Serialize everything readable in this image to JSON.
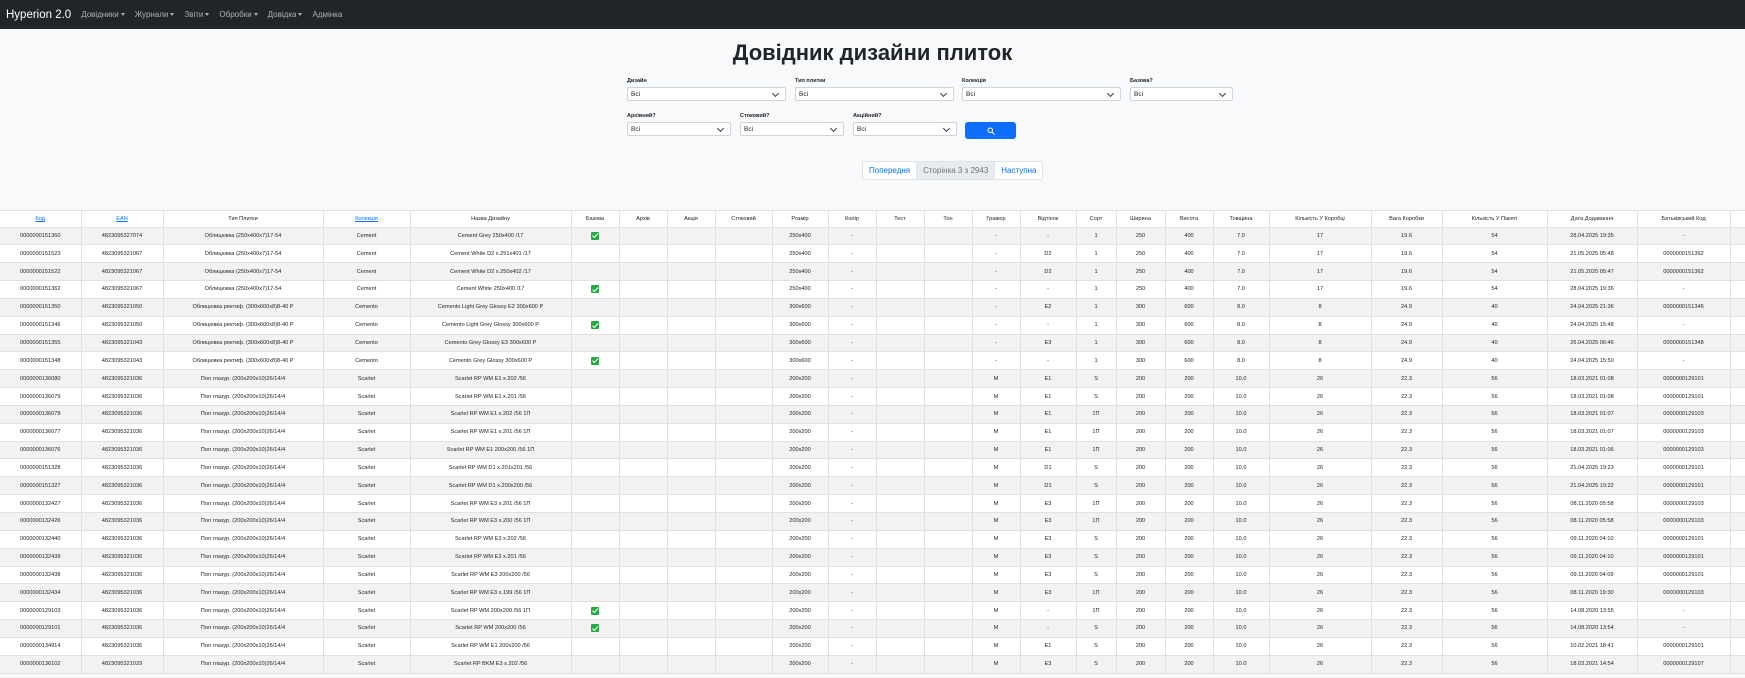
{
  "navbar": {
    "brand": "Hyperion 2.0",
    "items": [
      {
        "label": "Довідники",
        "dropdown": true
      },
      {
        "label": "Журнали",
        "dropdown": true
      },
      {
        "label": "Звіти",
        "dropdown": true
      },
      {
        "label": "Обробки",
        "dropdown": true
      },
      {
        "label": "Довідка",
        "dropdown": true
      },
      {
        "label": "Адмінка",
        "dropdown": false
      }
    ]
  },
  "page": {
    "title": "Довідник дизайни плиток"
  },
  "filters": {
    "design": {
      "label": "Дизайн",
      "value": "Всі"
    },
    "tile_type": {
      "label": "Тип плитки",
      "value": "Всі"
    },
    "collection": {
      "label": "Колекція",
      "value": "Всі"
    },
    "base": {
      "label": "Базова?",
      "value": "Всі"
    },
    "archive": {
      "label": "Архівний?",
      "value": "Всі"
    },
    "stock": {
      "label": "Стоковий?",
      "value": "Всі"
    },
    "promo": {
      "label": "Акційний?",
      "value": "Всі"
    },
    "search_icon": "search-icon"
  },
  "pagination": {
    "prev": "Попередня",
    "current": "Сторінка 3 з 2943",
    "next": "Наступна"
  },
  "colors": {
    "navbar": "#212529",
    "primary": "#0d6efd",
    "check": "#28a745"
  },
  "table": {
    "columns": [
      {
        "label": "Код",
        "sortable": true
      },
      {
        "label": "EAN",
        "sortable": true
      },
      {
        "label": "Тип Плитки",
        "sortable": false
      },
      {
        "label": "Колекція",
        "sortable": true
      },
      {
        "label": "Назва Дизайну",
        "sortable": false
      },
      {
        "label": "Базова",
        "sortable": false
      },
      {
        "label": "Архів",
        "sortable": false
      },
      {
        "label": "Акція",
        "sortable": false
      },
      {
        "label": "Стоковий",
        "sortable": false
      },
      {
        "label": "Розмір",
        "sortable": false
      },
      {
        "label": "Колір",
        "sortable": false
      },
      {
        "label": "Тест",
        "sortable": false
      },
      {
        "label": "Тон",
        "sortable": false
      },
      {
        "label": "Гравюр",
        "sortable": false
      },
      {
        "label": "Відтінок",
        "sortable": false
      },
      {
        "label": "Сорт",
        "sortable": false
      },
      {
        "label": "Ширина",
        "sortable": false
      },
      {
        "label": "Висота",
        "sortable": false
      },
      {
        "label": "Товщина",
        "sortable": false
      },
      {
        "label": "Кількість У Коробці",
        "sortable": false
      },
      {
        "label": "Вага Коробки",
        "sortable": false
      },
      {
        "label": "Кількість У Пакеті",
        "sortable": false
      },
      {
        "label": "Дата Додавання",
        "sortable": false
      },
      {
        "label": "Батьківський Код",
        "sortable": false
      },
      {
        "label": "",
        "sortable": false
      }
    ],
    "rows": [
      [
        "0000000151360",
        "4823095327074",
        "Облицювка (250х400х7)17-54",
        "Cement",
        "Cement Grey 250x400 /17",
        true,
        "",
        "",
        "",
        "250x400",
        "-",
        "",
        "",
        "-",
        "-",
        "1",
        "250",
        "400",
        "7.0",
        "17",
        "19.6",
        "54",
        "28.04.2025 19:35",
        "-",
        ""
      ],
      [
        "0000000151523",
        "4823095321067",
        "Облицювка (250х400х7)17-54",
        "Cement",
        "Cement White D2 x.251x401 /17",
        false,
        "",
        "",
        "",
        "250x400",
        "-",
        "",
        "",
        "-",
        "D2",
        "1",
        "250",
        "400",
        "7.0",
        "17",
        "19.6",
        "54",
        "21.05.2025 05:48",
        "0000000151362",
        ""
      ],
      [
        "0000000151522",
        "4823095321067",
        "Облицювка (250х400х7)17-54",
        "Cement",
        "Cement White D2 x.250x402 /17",
        false,
        "",
        "",
        "",
        "250x400",
        "-",
        "",
        "",
        "-",
        "D2",
        "1",
        "250",
        "400",
        "7.0",
        "17",
        "19.6",
        "54",
        "21.05.2025 05:47",
        "0000000151362",
        ""
      ],
      [
        "0000000151362",
        "4823095321067",
        "Облицювка (250х400х7)17-54",
        "Cement",
        "Cement White 250x400 /17",
        true,
        "",
        "",
        "",
        "250x400",
        "-",
        "",
        "",
        "-",
        "-",
        "1",
        "250",
        "400",
        "7.0",
        "17",
        "19.6",
        "54",
        "28.04.2025 19:36",
        "-",
        ""
      ],
      [
        "0000000151350",
        "4823095321050",
        "Облицювка ректиф. (300х600х8)8-40 Р",
        "Cemento",
        "Cemento Light Grey Glossy E2 300x600 P",
        false,
        "",
        "",
        "",
        "300x600",
        "-",
        "",
        "",
        "-",
        "E2",
        "1",
        "300",
        "600",
        "8.0",
        "8",
        "24.9",
        "40",
        "24.04.2025 21:36",
        "0000000151346",
        ""
      ],
      [
        "0000000151346",
        "4823095321050",
        "Облицювка ректиф. (300х600х8)8-40 Р",
        "Cemento",
        "Cemento Light Grey Glossy 300x600 P",
        true,
        "",
        "",
        "",
        "300x600",
        "-",
        "",
        "",
        "-",
        "-",
        "1",
        "300",
        "600",
        "8.0",
        "8",
        "24.9",
        "40",
        "24.04.2025 15:48",
        "-",
        ""
      ],
      [
        "0000000151355",
        "4823095321043",
        "Облицювка ректиф. (300х600х8)8-40 Р",
        "Cemento",
        "Cemento Grey Glossy E3 300x600 P",
        false,
        "",
        "",
        "",
        "300x600",
        "-",
        "",
        "",
        "-",
        "E3",
        "1",
        "300",
        "600",
        "8.0",
        "8",
        "24.9",
        "40",
        "26.04.2025 06:46",
        "0000000151348",
        ""
      ],
      [
        "0000000151348",
        "4823095321043",
        "Облицювка ректиф. (300х600х8)8-40 Р",
        "Cemento",
        "Cemento Grey Glossy 300x600 P",
        true,
        "",
        "",
        "",
        "300x600",
        "-",
        "",
        "",
        "-",
        "-",
        "1",
        "300",
        "600",
        "8.0",
        "8",
        "24.9",
        "40",
        "24.04.2025 15:50",
        "-",
        ""
      ],
      [
        "0000000136080",
        "4823095321036",
        "Пол глазур. (200х200х10)26/14/4",
        "Scarlet",
        "Scarlet RP WM E1 x.202 /56",
        false,
        "",
        "",
        "",
        "200x200",
        "-",
        "",
        "",
        "M",
        "E1",
        "S",
        "200",
        "200",
        "10.0",
        "26",
        "22.3",
        "56",
        "18.03.2021 01:08",
        "0000000129101",
        ""
      ],
      [
        "0000000136079",
        "4823095321036",
        "Пол глазур. (200х200х10)26/14/4",
        "Scarlet",
        "Scarlet RP WM E1 x.201 /56",
        false,
        "",
        "",
        "",
        "200x200",
        "-",
        "",
        "",
        "M",
        "E1",
        "S",
        "200",
        "200",
        "10.0",
        "26",
        "22.3",
        "56",
        "18.03.2021 01:08",
        "0000000129101",
        ""
      ],
      [
        "0000000136078",
        "4823095321036",
        "Пол глазур. (200х200х10)26/14/4",
        "Scarlet",
        "Scarlet RP WM E1 x.202 /56 1П",
        false,
        "",
        "",
        "",
        "200x200",
        "-",
        "",
        "",
        "M",
        "E1",
        "1П",
        "200",
        "200",
        "10.0",
        "26",
        "22.3",
        "56",
        "18.03.2021 01:07",
        "0000000129103",
        ""
      ],
      [
        "0000000136077",
        "4823095321036",
        "Пол глазур. (200х200х10)26/14/4",
        "Scarlet",
        "Scarlet RP WM E1 x.201 /56 1П",
        false,
        "",
        "",
        "",
        "200x200",
        "-",
        "",
        "",
        "M",
        "E1",
        "1П",
        "200",
        "200",
        "10.0",
        "26",
        "22.3",
        "56",
        "18.03.2021 01:07",
        "0000000129103",
        ""
      ],
      [
        "0000000136076",
        "4823095321036",
        "Пол глазур. (200х200х10)26/14/4",
        "Scarlet",
        "Scarlet RP WM E1 200x200 /56 1П",
        false,
        "",
        "",
        "",
        "200x200",
        "-",
        "",
        "",
        "M",
        "E1",
        "1П",
        "200",
        "200",
        "10.0",
        "26",
        "22.3",
        "56",
        "18.03.2021 01:06",
        "0000000129103",
        ""
      ],
      [
        "0000000151328",
        "4823095321036",
        "Пол глазур. (200х200х10)26/14/4",
        "Scarlet",
        "Scarlet RP WM D1 x.201x201 /56",
        false,
        "",
        "",
        "",
        "200x200",
        "-",
        "",
        "",
        "M",
        "D1",
        "S",
        "200",
        "200",
        "10.0",
        "26",
        "22.3",
        "56",
        "21.04.2025 19:23",
        "0000000129101",
        ""
      ],
      [
        "0000000151327",
        "4823095321036",
        "Пол глазур. (200х200х10)26/14/4",
        "Scarlet",
        "Scarlet RP WM D1 x.200x200 /56",
        false,
        "",
        "",
        "",
        "200x200",
        "-",
        "",
        "",
        "M",
        "D1",
        "S",
        "200",
        "200",
        "10.0",
        "26",
        "22.3",
        "56",
        "21.04.2025 19:22",
        "0000000129101",
        ""
      ],
      [
        "0000000132427",
        "4823095321036",
        "Пол глазур. (200х200х10)26/14/4",
        "Scarlet",
        "Scarlet RP WM E3 x.201 /56 1П",
        false,
        "",
        "",
        "",
        "200x200",
        "-",
        "",
        "",
        "M",
        "E3",
        "1П",
        "200",
        "200",
        "10.0",
        "26",
        "22.3",
        "56",
        "08.11.2020 05:58",
        "0000000129103",
        ""
      ],
      [
        "0000000132426",
        "4823095321036",
        "Пол глазур. (200х200х10)26/14/4",
        "Scarlet",
        "Scarlet RP WM E3 x.200 /56 1П",
        false,
        "",
        "",
        "",
        "200x200",
        "-",
        "",
        "",
        "M",
        "E3",
        "1П",
        "200",
        "200",
        "10.0",
        "26",
        "22.3",
        "56",
        "08.11.2020 05:58",
        "0000000129103",
        ""
      ],
      [
        "0000000132440",
        "4823095321036",
        "Пол глазур. (200х200х10)26/14/4",
        "Scarlet",
        "Scarlet RP WM E3 x.202 /56",
        false,
        "",
        "",
        "",
        "200x200",
        "-",
        "",
        "",
        "M",
        "E3",
        "S",
        "200",
        "200",
        "10.0",
        "26",
        "22.3",
        "56",
        "09.11.2020 04:10",
        "0000000129101",
        ""
      ],
      [
        "0000000132439",
        "4823095321036",
        "Пол глазур. (200х200х10)26/14/4",
        "Scarlet",
        "Scarlet RP WM E3 x.201 /56",
        false,
        "",
        "",
        "",
        "200x200",
        "-",
        "",
        "",
        "M",
        "E3",
        "S",
        "200",
        "200",
        "10.0",
        "26",
        "22.3",
        "56",
        "09.11.2020 04:10",
        "0000000129101",
        ""
      ],
      [
        "0000000132438",
        "4823095321036",
        "Пол глазур. (200х200х10)26/14/4",
        "Scarlet",
        "Scarlet RP WM E3 200x200 /56",
        false,
        "",
        "",
        "",
        "200x200",
        "-",
        "",
        "",
        "M",
        "E3",
        "S",
        "200",
        "200",
        "10.0",
        "26",
        "22.3",
        "56",
        "09.11.2020 04:09",
        "0000000129101",
        ""
      ],
      [
        "0000000132434",
        "4823095321036",
        "Пол глазур. (200х200х10)26/14/4",
        "Scarlet",
        "Scarlet RP WM E3 x.199 /56 1П",
        false,
        "",
        "",
        "",
        "200x200",
        "-",
        "",
        "",
        "M",
        "E3",
        "1П",
        "200",
        "200",
        "10.0",
        "26",
        "22.3",
        "56",
        "08.11.2020 19:30",
        "0000000129103",
        ""
      ],
      [
        "0000000129103",
        "4823095321036",
        "Пол глазур. (200х200х10)26/14/4",
        "Scarlet",
        "Scarlet RP WM 200x200 /56 1П",
        true,
        "",
        "",
        "",
        "200x200",
        "-",
        "",
        "",
        "M",
        "-",
        "1П",
        "200",
        "200",
        "10.0",
        "26",
        "22.3",
        "56",
        "14.08.2020 13:55",
        "-",
        ""
      ],
      [
        "0000000129101",
        "4823095321036",
        "Пол глазур. (200х200х10)26/14/4",
        "Scarlet",
        "Scarlet RP WM 200x200 /56",
        true,
        "",
        "",
        "",
        "200x200",
        "-",
        "",
        "",
        "M",
        "-",
        "S",
        "200",
        "200",
        "10.0",
        "26",
        "22.3",
        "56",
        "14.08.2020 13:54",
        "-",
        ""
      ],
      [
        "0000000134914",
        "4823095321036",
        "Пол глазур. (200х200х10)26/14/4",
        "Scarlet",
        "Scarlet RP WM E1 200x200 /56",
        false,
        "",
        "",
        "",
        "200x200",
        "-",
        "",
        "",
        "M",
        "E1",
        "S",
        "200",
        "200",
        "10.0",
        "26",
        "22.3",
        "56",
        "10.02.2021 18:41",
        "0000000129101",
        ""
      ],
      [
        "0000000136102",
        "4823095321029",
        "Пол глазур. (200х200х10)26/14/4",
        "Scarlet",
        "Scarlet RP BKM E3 x.202 /56",
        false,
        "",
        "",
        "",
        "200x200",
        "-",
        "",
        "",
        "M",
        "E3",
        "S",
        "200",
        "200",
        "10.0",
        "26",
        "22.3",
        "56",
        "18.03.2021 14:54",
        "0000000129107",
        ""
      ]
    ]
  }
}
